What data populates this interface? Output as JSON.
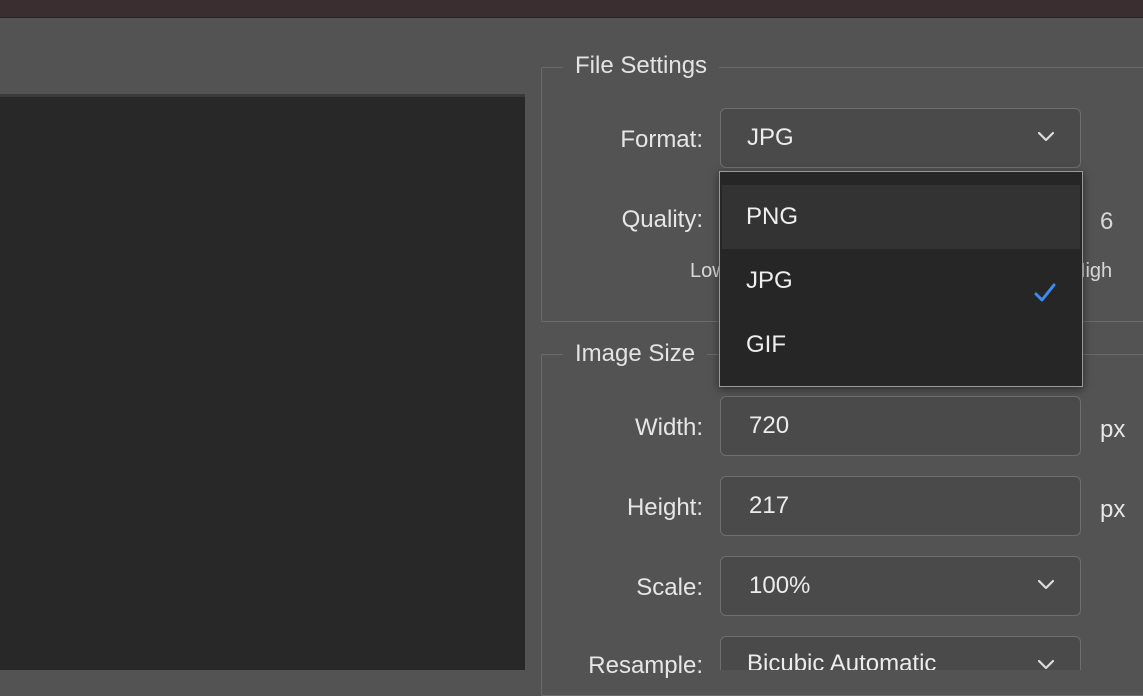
{
  "file_settings": {
    "legend": "File Settings",
    "format_label": "Format:",
    "format_value": "JPG",
    "quality_label": "Quality:",
    "quality_value": "6",
    "quality_low": "Low",
    "quality_high": "High"
  },
  "format_dropdown": {
    "options": [
      "PNG",
      "JPG",
      "GIF"
    ],
    "selected": "JPG"
  },
  "image_size": {
    "legend": "Image Size",
    "width_label": "Width:",
    "width_value": "720",
    "width_unit": "px",
    "height_label": "Height:",
    "height_value": "217",
    "height_unit": "px",
    "scale_label": "Scale:",
    "scale_value": "100%",
    "resample_label": "Resample:",
    "resample_value": "Bicubic Automatic"
  },
  "colors": {
    "checkmark": "#3d8bf0",
    "panel_bg": "#535353",
    "preview_bg": "#282828"
  }
}
